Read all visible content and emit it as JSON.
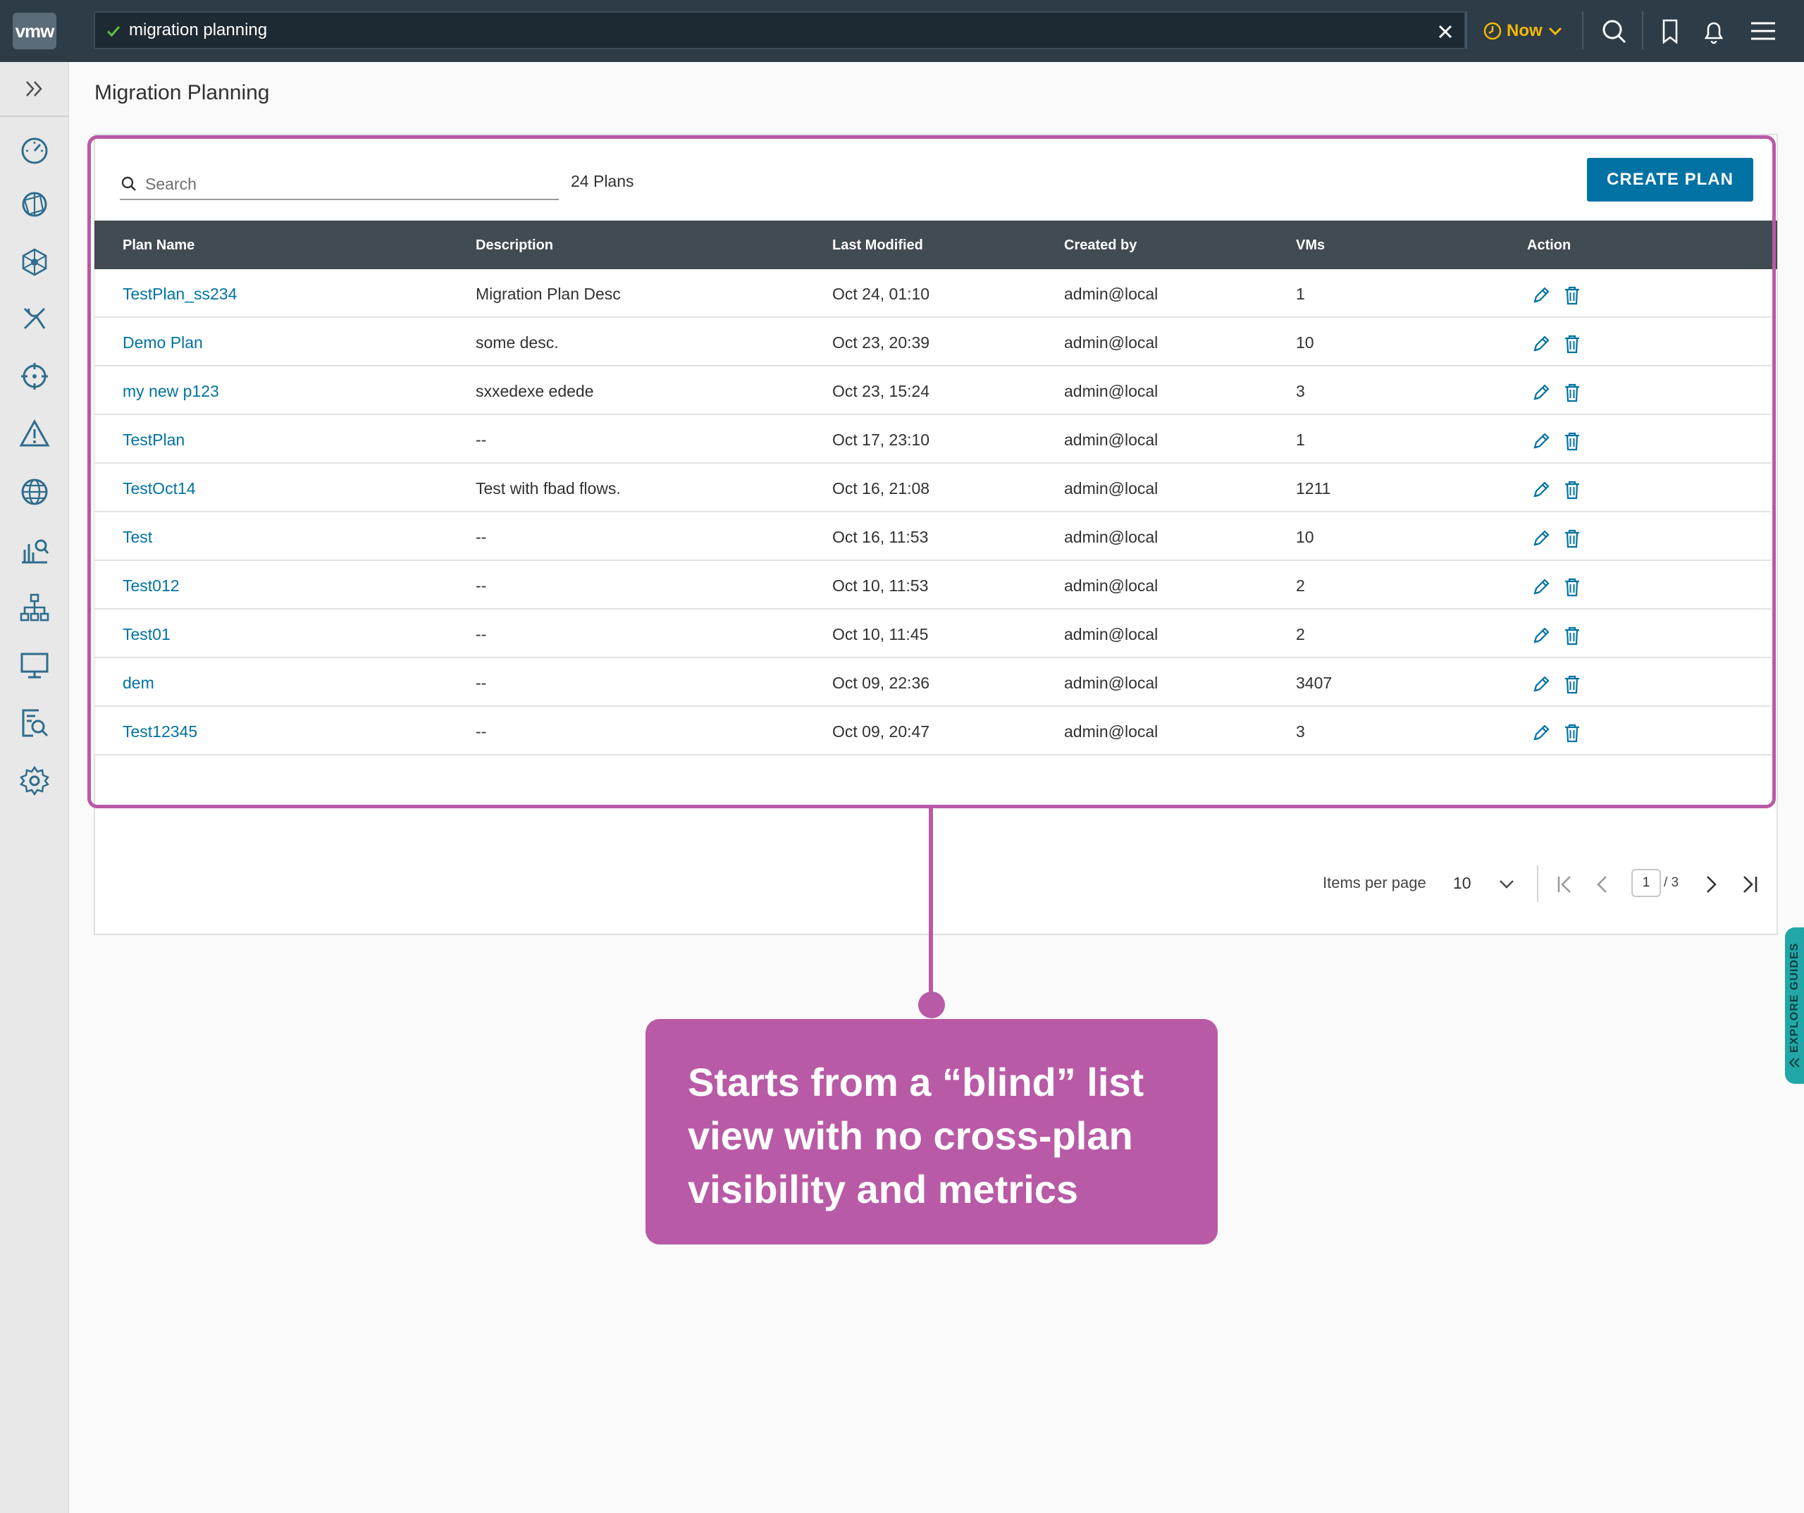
{
  "header": {
    "logo_text": "vmw",
    "search_value": "migration planning",
    "time_label": "Now",
    "icons": [
      "check-icon",
      "close-icon",
      "clock-icon",
      "chevron-down-icon",
      "search-icon",
      "bookmark-icon",
      "bell-icon",
      "menu-icon"
    ],
    "accent_color": "#f5b800"
  },
  "sidebar": {
    "toggle_icon": "double-chevron-right-icon",
    "items": [
      "dashboard-icon",
      "network-ball-icon",
      "topology-icon",
      "tools-icon",
      "crosshair-icon",
      "alert-icon",
      "globe-icon",
      "analytics-search-icon",
      "hierarchy-icon",
      "monitor-icon",
      "report-search-icon",
      "gear-icon"
    ]
  },
  "page": {
    "title": "Migration Planning"
  },
  "toolbar": {
    "search_placeholder": "Search",
    "plans_count": "24 Plans",
    "create_label": "CREATE PLAN",
    "brand_color": "#0072a3"
  },
  "table": {
    "columns": [
      "Plan Name",
      "Description",
      "Last Modified",
      "Created by",
      "VMs",
      "Action"
    ],
    "rows": [
      {
        "name": "TestPlan_ss234",
        "description": "Migration Plan Desc",
        "modified": "Oct 24, 01:10",
        "created_by": "admin@local",
        "vms": "1"
      },
      {
        "name": "Demo Plan",
        "description": "some desc.",
        "modified": "Oct 23, 20:39",
        "created_by": "admin@local",
        "vms": "10"
      },
      {
        "name": "my new p123",
        "description": "sxxedexe edede",
        "modified": "Oct 23, 15:24",
        "created_by": "admin@local",
        "vms": "3"
      },
      {
        "name": "TestPlan",
        "description": "--",
        "modified": "Oct 17, 23:10",
        "created_by": "admin@local",
        "vms": "1"
      },
      {
        "name": "TestOct14",
        "description": "Test with fbad flows.",
        "modified": "Oct 16, 21:08",
        "created_by": "admin@local",
        "vms": "1211"
      },
      {
        "name": "Test",
        "description": "--",
        "modified": "Oct 16, 11:53",
        "created_by": "admin@local",
        "vms": "10"
      },
      {
        "name": "Test012",
        "description": "--",
        "modified": "Oct 10, 11:53",
        "created_by": "admin@local",
        "vms": "2"
      },
      {
        "name": "Test01",
        "description": "--",
        "modified": "Oct 10, 11:45",
        "created_by": "admin@local",
        "vms": "2"
      },
      {
        "name": "dem",
        "description": "--",
        "modified": "Oct 09, 22:36",
        "created_by": "admin@local",
        "vms": "3407"
      },
      {
        "name": "Test12345",
        "description": "--",
        "modified": "Oct 09, 20:47",
        "created_by": "admin@local",
        "vms": "3"
      }
    ]
  },
  "pagination": {
    "items_per_page_label": "Items per page",
    "items_per_page": "10",
    "current_page": "1",
    "total_pages": "/ 3"
  },
  "annotation": {
    "text": "Starts from a “blind” list view with no cross-plan visibility and metrics",
    "color": "#b95aa6"
  },
  "explore_guides": {
    "label": "EXPLORE GUIDES",
    "color": "#22a7a8"
  }
}
